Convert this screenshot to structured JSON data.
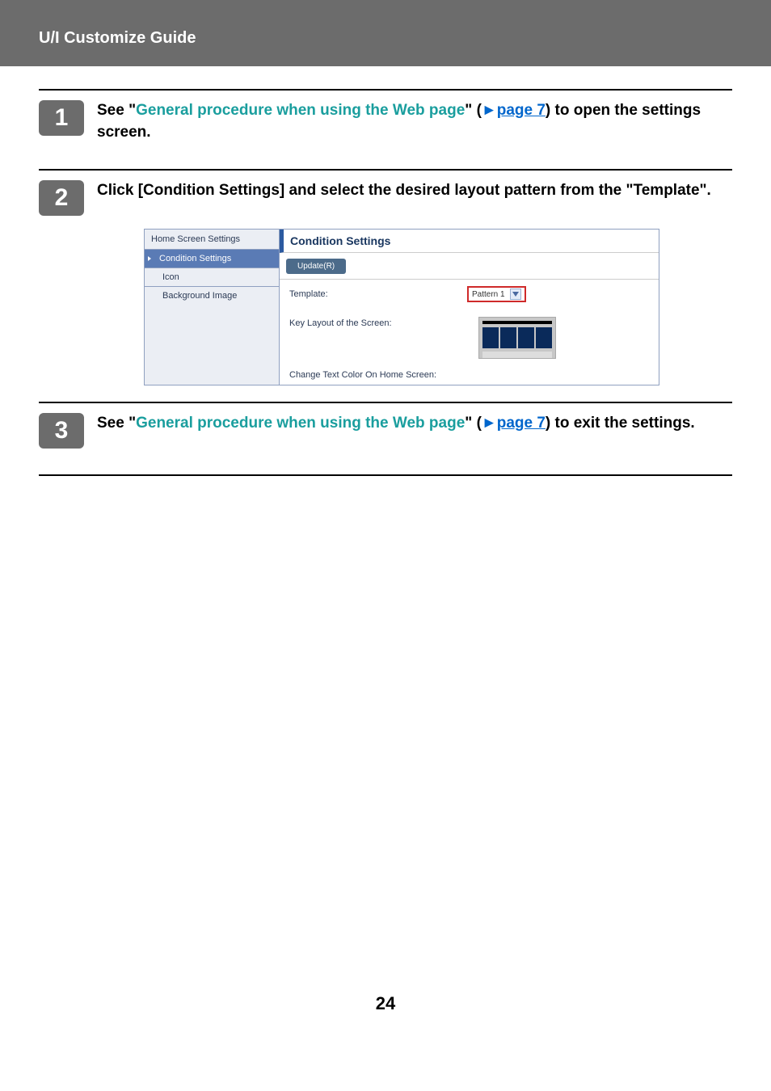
{
  "header": {
    "title": "U/I Customize Guide"
  },
  "steps": [
    {
      "num": "1",
      "prefix": "See \"",
      "link_text": "General procedure when using the Web page",
      "mid": "\" (",
      "arrow": "►",
      "page_ref": "page 7",
      "suffix": ") to open the settings screen."
    },
    {
      "num": "2",
      "full_text": "Click [Condition Settings] and select the desired layout pattern from the \"Template\"."
    },
    {
      "num": "3",
      "prefix": "See \"",
      "link_text": "General procedure when using the Web page",
      "mid": "\" (",
      "arrow": "►",
      "page_ref": "page 7",
      "suffix": ") to exit the settings."
    }
  ],
  "screenshot": {
    "sidebar": {
      "heading": "Home Screen Settings",
      "items": [
        "Condition Settings",
        "Icon",
        "Background Image"
      ]
    },
    "main": {
      "title": "Condition Settings",
      "update_btn": "Update(R)",
      "template_label": "Template:",
      "template_value": "Pattern 1",
      "key_layout_label": "Key Layout of the Screen:",
      "text_color_label": "Change Text Color On Home Screen:"
    }
  },
  "page_number": "24"
}
